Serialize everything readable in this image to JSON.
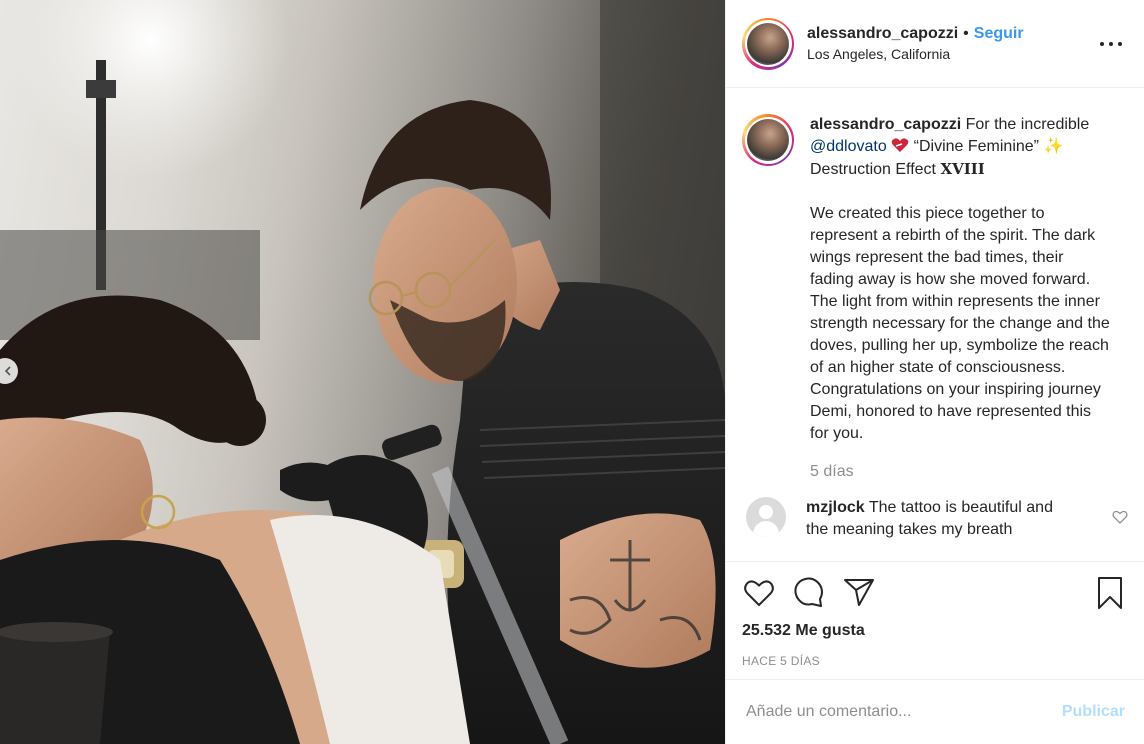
{
  "post": {
    "username": "alessandro_capozzi",
    "separator": "•",
    "follow_label": "Seguir",
    "location": "Los Angeles, California",
    "photo_alt": "Tattoo artist working on a client"
  },
  "caption": {
    "username": "alessandro_capozzi",
    "text_1": "For the incredible",
    "mention": "@ddlovato",
    "text_2": "“Divine Feminine”",
    "sparkle": "✨",
    "text_3": "Destruction Effect",
    "roman": "XVIII",
    "paragraph": "We created this piece together to represent a rebirth of the spirit. The dark wings represent the bad times, their fading away is how she moved forward. The light from within represents the inner strength necessary for the change and the doves, pulling her up, symbolize the reach of an higher state of consciousness. Congratulations on your inspiring journey Demi, honored to have represented this for you.",
    "time_ago": "5 días"
  },
  "comments": [
    {
      "username": "mzjlock",
      "text": "The tattoo is beautiful and the meaning takes my breath"
    }
  ],
  "stats": {
    "likes": "25.532 Me gusta",
    "date": "HACE 5 DÍAS"
  },
  "composer": {
    "placeholder": "Añade un comentario...",
    "publish_label": "Publicar"
  },
  "colors": {
    "link": "#3897f0",
    "mention": "#00376b",
    "muted": "#8e8e8e",
    "publish_disabled": "#b2dffc"
  },
  "icons": [
    "heart-icon",
    "comment-icon",
    "share-icon",
    "bookmark-icon",
    "more-icon",
    "chevron-left-icon"
  ]
}
